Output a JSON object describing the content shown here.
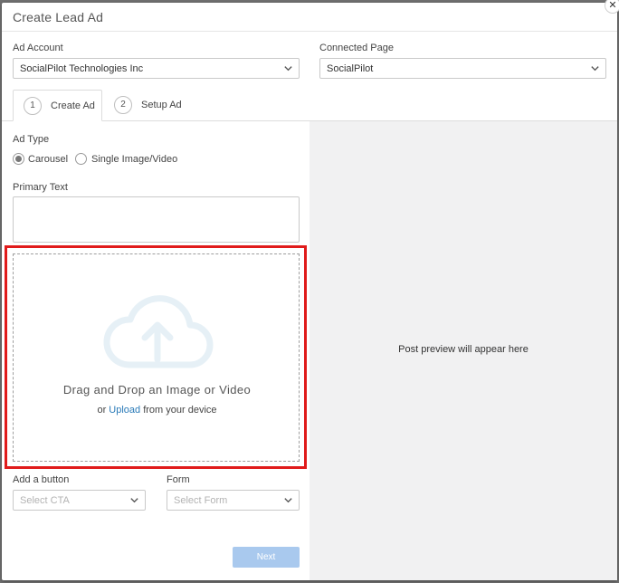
{
  "modal": {
    "title": "Create Lead Ad",
    "close_glyph": "✕"
  },
  "ad_account": {
    "label": "Ad Account",
    "value": "SocialPilot Technologies Inc"
  },
  "connected_page": {
    "label": "Connected Page",
    "value": "SocialPilot"
  },
  "tabs": [
    {
      "num": "1",
      "label": "Create Ad",
      "active": true
    },
    {
      "num": "2",
      "label": "Setup Ad",
      "active": false
    }
  ],
  "ad_type": {
    "label": "Ad Type",
    "options": [
      {
        "label": "Carousel",
        "checked": true
      },
      {
        "label": "Single Image/Video",
        "checked": false
      }
    ]
  },
  "primary_text": {
    "label": "Primary Text",
    "value": ""
  },
  "dropzone": {
    "icon": "cloud-upload-icon",
    "title": "Drag and Drop an Image or Video",
    "sub_prefix": "or ",
    "sub_link": "Upload",
    "sub_suffix": " from your device"
  },
  "cta": {
    "label": "Add a button",
    "placeholder": "Select CTA"
  },
  "form": {
    "label": "Form",
    "placeholder": "Select Form"
  },
  "next_button": "Next",
  "preview": {
    "text": "Post preview will appear here"
  },
  "colors": {
    "highlight": "#e01b1b",
    "link": "#2a7ab8",
    "next_disabled": "#a9c9ee"
  }
}
